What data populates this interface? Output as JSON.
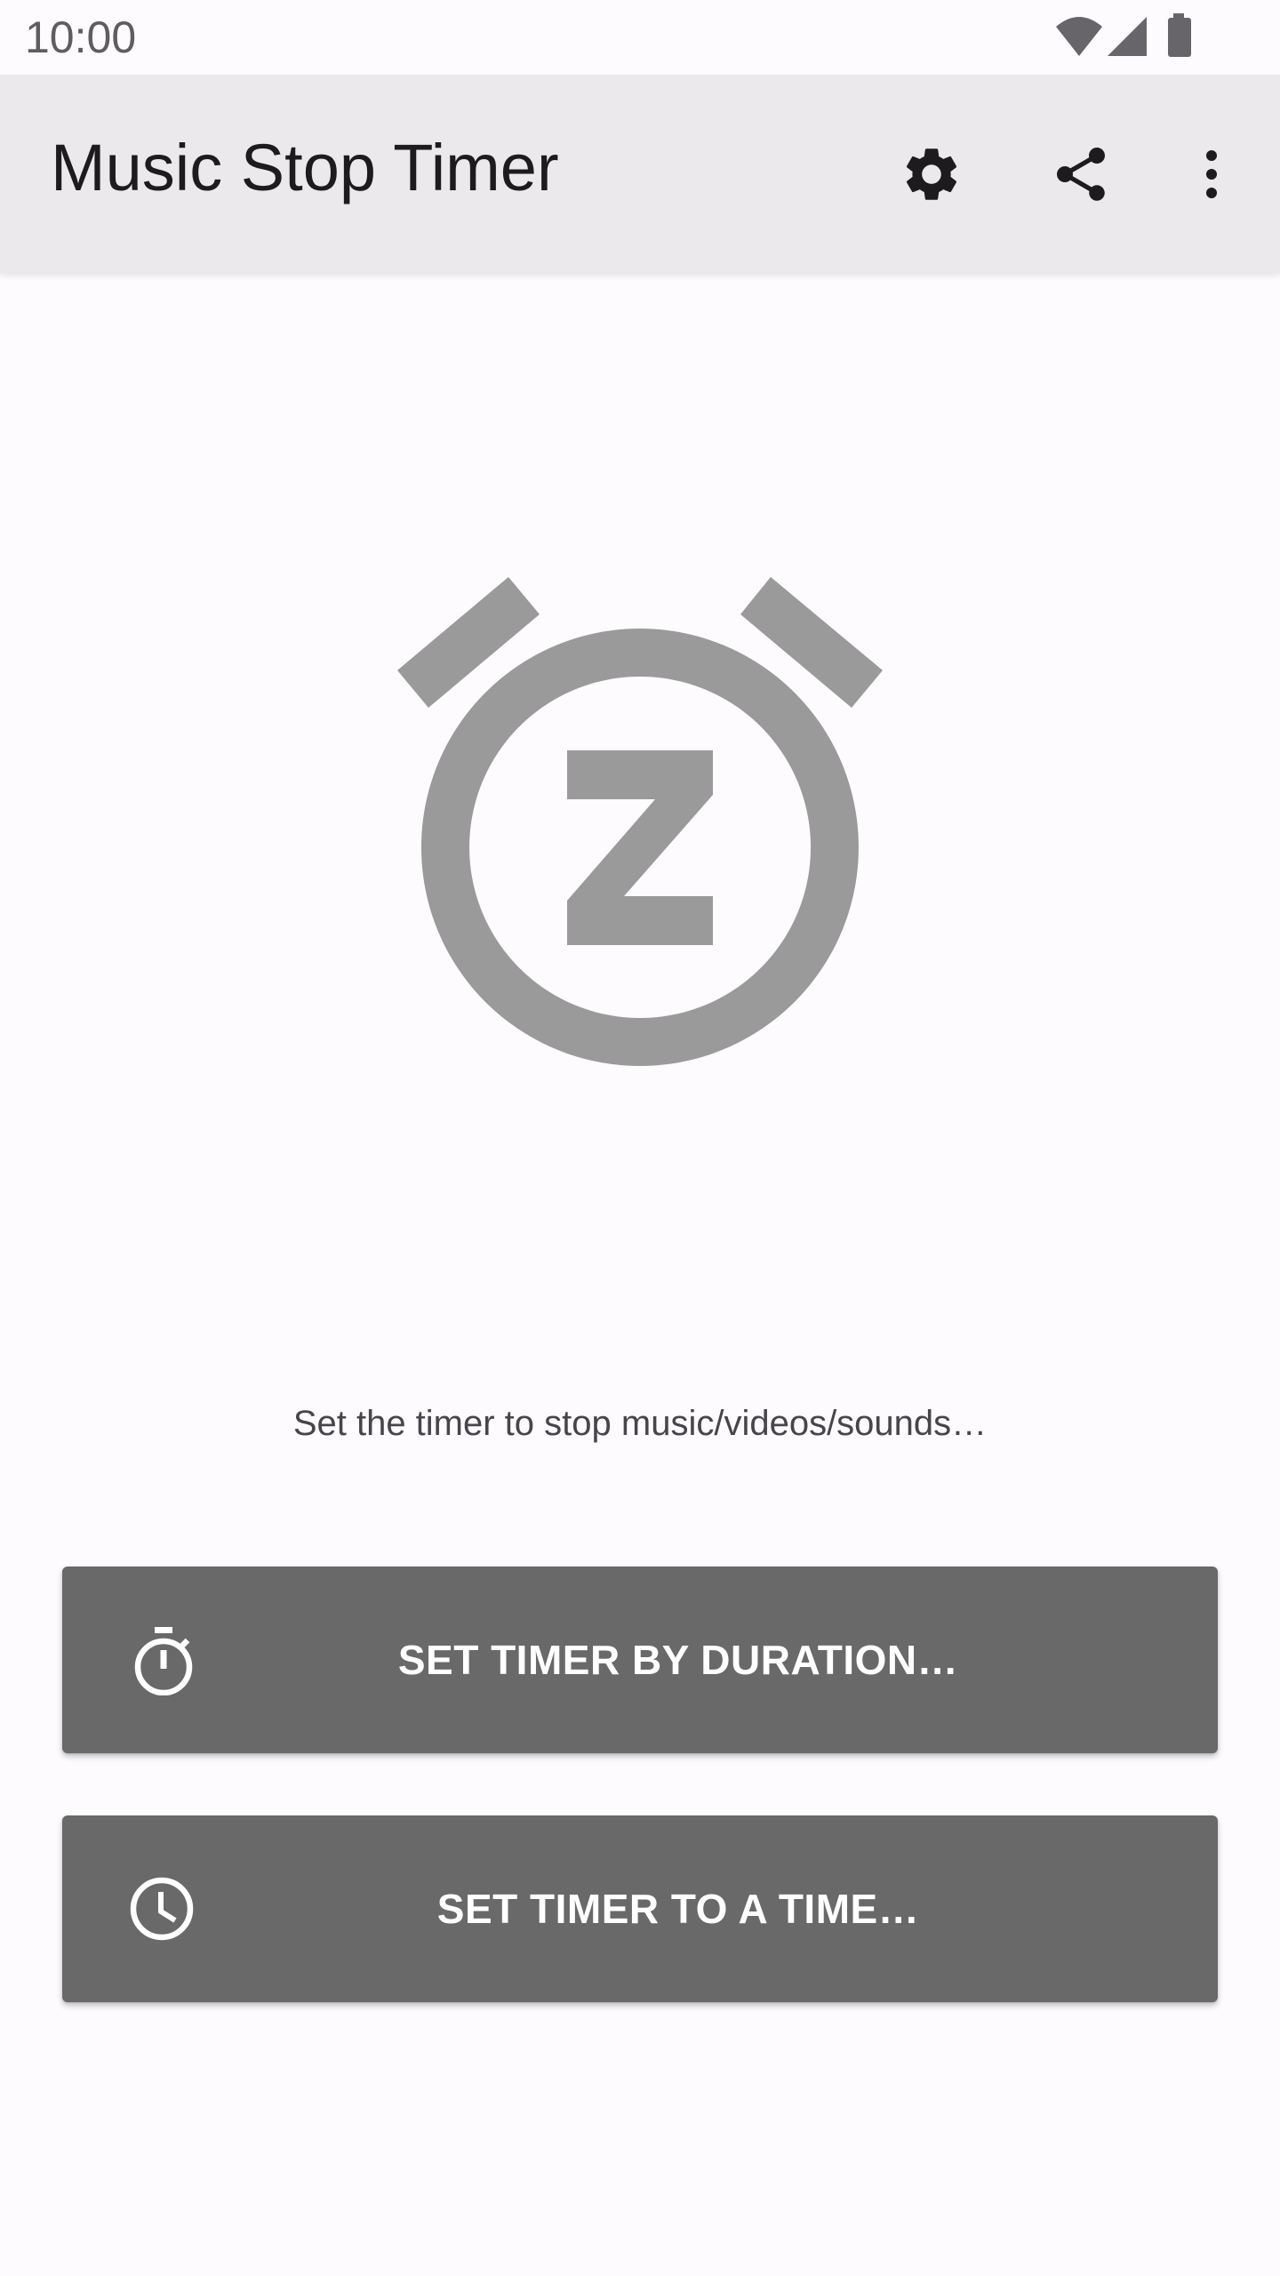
{
  "status_bar": {
    "time": "10:00",
    "icons": [
      "wifi-icon",
      "cellular-signal-icon",
      "battery-icon"
    ]
  },
  "app_bar": {
    "title": "Music Stop Timer",
    "actions": [
      {
        "name": "settings",
        "icon": "gear-icon"
      },
      {
        "name": "share",
        "icon": "share-icon"
      },
      {
        "name": "more-options",
        "icon": "more-vert-icon"
      }
    ]
  },
  "main": {
    "illustration": "alarm-clock-z-icon",
    "subtitle": "Set the timer to stop music/videos/sounds…",
    "buttons": [
      {
        "label": "SET TIMER BY DURATION…",
        "icon": "stopwatch-icon"
      },
      {
        "label": "SET TIMER TO A TIME…",
        "icon": "clock-icon"
      }
    ]
  },
  "colors": {
    "background": "#fdfbfe",
    "app_bar": "#ece9ec",
    "button": "#696969",
    "illustration": "#9a9a9a",
    "icon_dark": "#1d1b1e"
  }
}
